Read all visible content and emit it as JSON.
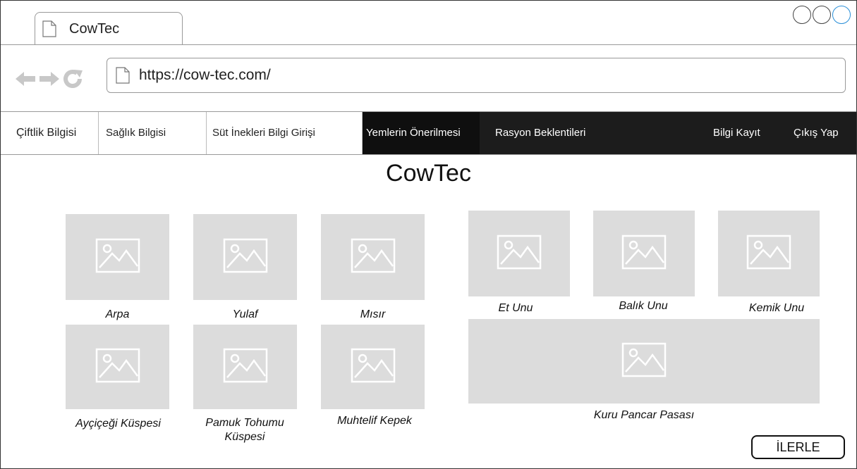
{
  "browser": {
    "tab_title": "CowTec",
    "url": "https://cow-tec.com/"
  },
  "menu": {
    "items": [
      {
        "label": "Çiftlik Bilgisi"
      },
      {
        "label": "Sağlık Bilgisi"
      },
      {
        "label": "Süt İnekleri Bilgi Girişi"
      },
      {
        "label": "Yemlerin Önerilmesi"
      },
      {
        "label": "Rasyon Beklentileri"
      },
      {
        "label": "Bilgi Kayıt"
      },
      {
        "label": "Çıkış Yap"
      }
    ],
    "active": "Yemlerin Önerilmesi"
  },
  "main": {
    "title": "CowTec",
    "feeds": [
      {
        "label": "Arpa"
      },
      {
        "label": "Yulaf"
      },
      {
        "label": "Mısır"
      },
      {
        "label": "Ayçiçeği Küspesi"
      },
      {
        "label": "Pamuk Tohumu Küspesi"
      },
      {
        "label": "Muhtelif Kepek"
      },
      {
        "label": "Et Unu"
      },
      {
        "label": "Balık Unu"
      },
      {
        "label": "Kemik Unu"
      },
      {
        "label": "Kuru Pancar Pasası"
      }
    ],
    "next_button": "İLERLE"
  }
}
